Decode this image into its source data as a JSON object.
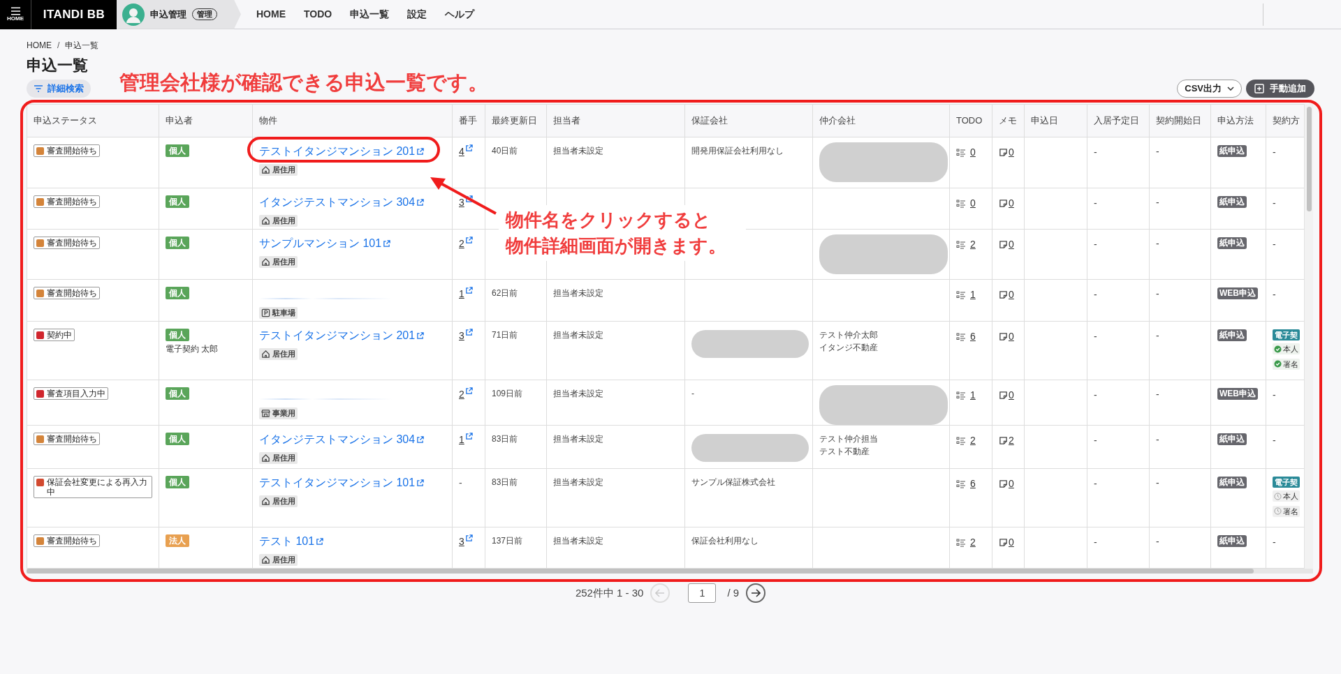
{
  "header": {
    "menu_label": "HOME",
    "brand": "ITANDI BB",
    "product": "申込管理",
    "product_badge": "管理",
    "nav": [
      "HOME",
      "TODO",
      "申込一覧",
      "設定",
      "ヘルプ"
    ]
  },
  "breadcrumb": [
    "HOME",
    "申込一覧"
  ],
  "breadcrumb_separator": "/",
  "page_title": "申込一覧",
  "filter_button": "詳細検索",
  "csv_button": "CSV出力",
  "add_button": "手動追加",
  "annotation": {
    "heading": "管理会社様が確認できる申込一覧です。",
    "callout": [
      "物件名をクリックすると",
      "物件詳細画面が開きます。"
    ]
  },
  "table": {
    "columns": [
      "申込ステータス",
      "申込者",
      "物件",
      "番手",
      "最終更新日",
      "担当者",
      "保証会社",
      "仲介会社",
      "TODO",
      "メモ",
      "申込日",
      "入居予定日",
      "契約開始日",
      "申込方法",
      "契約方"
    ],
    "rows": [
      {
        "status": {
          "label": "審査開始待ち",
          "color": "#d4843a"
        },
        "applicant": {
          "type": "個人",
          "color": "#5aa55a"
        },
        "property": {
          "name": "テストイタンジマンション 201",
          "name_hidden": false,
          "usage": "居住用",
          "kind": "residence"
        },
        "order": {
          "text": "4",
          "link": true
        },
        "updated": "40日前",
        "assignee": "担当者未設定",
        "guarantor": "開発用保証会社利用なし",
        "guarantor_redacted": false,
        "broker_redacted": true,
        "todo": "0",
        "memo": "0",
        "move_in": "-",
        "contract_start": "-",
        "method": "紙申込",
        "contract": "-"
      },
      {
        "status": {
          "label": "審査開始待ち",
          "color": "#d4843a"
        },
        "applicant": {
          "type": "個人",
          "color": "#5aa55a"
        },
        "property": {
          "name": "イタンジテストマンション 304",
          "name_hidden": false,
          "usage": "居住用",
          "kind": "residence"
        },
        "order": {
          "text": "3",
          "link": true
        },
        "guarantor_redacted": false,
        "broker_redacted": false,
        "todo": "0",
        "memo": "0",
        "move_in": "-",
        "contract_start": "-",
        "method": "紙申込",
        "contract": "-"
      },
      {
        "status": {
          "label": "審査開始待ち",
          "color": "#d4843a"
        },
        "applicant": {
          "type": "個人",
          "color": "#5aa55a"
        },
        "property": {
          "name": "サンプルマンション 101",
          "name_hidden": false,
          "usage": "居住用",
          "kind": "residence"
        },
        "order": {
          "text": "2",
          "link": true
        },
        "guarantor_redacted": false,
        "broker_redacted": true,
        "todo": "2",
        "memo": "0",
        "move_in": "-",
        "contract_start": "-",
        "method": "紙申込",
        "contract": "-"
      },
      {
        "status": {
          "label": "審査開始待ち",
          "color": "#d4843a"
        },
        "applicant": {
          "type": "個人",
          "color": "#5aa55a"
        },
        "property": {
          "name_hidden": true,
          "usage": "駐車場",
          "kind": "parking"
        },
        "order": {
          "text": "1",
          "link": true
        },
        "updated": "62日前",
        "assignee": "担当者未設定",
        "guarantor_redacted": false,
        "broker_redacted": false,
        "todo": "1",
        "memo": "0",
        "move_in": "-",
        "contract_start": "-",
        "method": "WEB申込",
        "contract": "-"
      },
      {
        "status": {
          "label": "契約中",
          "color": "#d0262d"
        },
        "applicant": {
          "type": "個人",
          "color": "#5aa55a",
          "name": "電子契約 太郎"
        },
        "property": {
          "name": "テストイタンジマンション 201",
          "name_hidden": false,
          "usage": "居住用",
          "kind": "residence"
        },
        "order": {
          "text": "3",
          "link": true
        },
        "updated": "71日前",
        "assignee": "担当者未設定",
        "guarantor_redacted": true,
        "broker": [
          "テスト仲介太郎",
          "イタンジ不動産"
        ],
        "broker_redacted": false,
        "todo": "6",
        "memo": "0",
        "move_in": "-",
        "contract_start": "-",
        "method": "紙申込",
        "contract_tag": "電子契",
        "contract_steps": [
          {
            "label": "本人",
            "done": true
          },
          {
            "label": "署名",
            "done": true
          }
        ]
      },
      {
        "status": {
          "label": "審査項目入力中",
          "color": "#d0262d"
        },
        "applicant": {
          "type": "個人",
          "color": "#5aa55a"
        },
        "property": {
          "name_hidden": true,
          "usage": "事業用",
          "kind": "business"
        },
        "order": {
          "text": "2",
          "link": true
        },
        "updated": "109日前",
        "assignee": "担当者未設定",
        "guarantor": "-",
        "guarantor_redacted": false,
        "broker_redacted": true,
        "todo": "1",
        "memo": "0",
        "move_in": "-",
        "contract_start": "-",
        "method": "WEB申込",
        "contract": "-"
      },
      {
        "status": {
          "label": "審査開始待ち",
          "color": "#d4843a"
        },
        "applicant": {
          "type": "個人",
          "color": "#5aa55a"
        },
        "property": {
          "name": "イタンジテストマンション 304",
          "name_hidden": false,
          "usage": "居住用",
          "kind": "residence"
        },
        "order": {
          "text": "1",
          "link": true
        },
        "updated": "83日前",
        "assignee": "担当者未設定",
        "guarantor_redacted": true,
        "broker": [
          "テスト仲介担当",
          "テスト不動産"
        ],
        "broker_redacted": false,
        "todo": "2",
        "memo": "2",
        "move_in": "-",
        "contract_start": "-",
        "method": "紙申込",
        "contract": "-"
      },
      {
        "status": {
          "label": "保証会社変更による再入力中",
          "color": "#d24a30"
        },
        "applicant": {
          "type": "個人",
          "color": "#5aa55a"
        },
        "property": {
          "name": "テストイタンジマンション 101",
          "name_hidden": false,
          "usage": "居住用",
          "kind": "residence"
        },
        "order": {
          "text": "-",
          "link": false
        },
        "updated": "83日前",
        "assignee": "担当者未設定",
        "guarantor": "サンプル保証株式会社",
        "guarantor_redacted": false,
        "broker_redacted": false,
        "todo": "6",
        "memo": "0",
        "move_in": "-",
        "contract_start": "-",
        "method": "紙申込",
        "contract_tag": "電子契",
        "contract_steps": [
          {
            "label": "本人",
            "done": false
          },
          {
            "label": "署名",
            "done": false
          }
        ]
      },
      {
        "status": {
          "label": "審査開始待ち",
          "color": "#d4843a"
        },
        "applicant": {
          "type": "法人",
          "color": "#e8a050"
        },
        "property": {
          "name": "テスト 101",
          "name_hidden": false,
          "usage": "居住用",
          "kind": "residence"
        },
        "order": {
          "text": "3",
          "link": true
        },
        "updated": "137日前",
        "assignee": "担当者未設定",
        "guarantor": "保証会社利用なし",
        "guarantor_redacted": false,
        "broker_redacted": false,
        "todo": "2",
        "memo": "0",
        "move_in": "-",
        "contract_start": "-",
        "method": "紙申込",
        "contract": "-"
      }
    ]
  },
  "pagination": {
    "summary": "252件中 1 - 30",
    "page": "1",
    "total": "/ 9",
    "prev_disabled": true
  }
}
